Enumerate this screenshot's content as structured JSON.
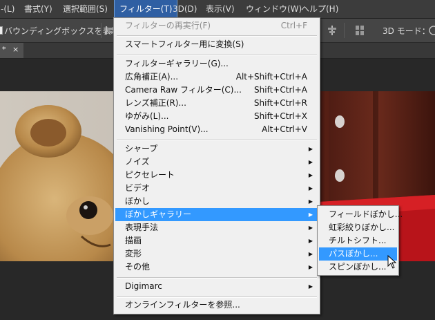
{
  "menubar": {
    "items": [
      {
        "label": "-(L)"
      },
      {
        "label": "書式(Y)"
      },
      {
        "label": "選択範囲(S)"
      },
      {
        "label": "フィルター(T)"
      },
      {
        "label": "3D(D)"
      },
      {
        "label": "表示(V)"
      },
      {
        "label": "ウィンドウ(W)"
      },
      {
        "label": "ヘルプ(H)"
      }
    ]
  },
  "options_bar": {
    "show_bounding_box_label": "バウンディングボックスを表示",
    "mode_label": "3D モード："
  },
  "document_tab": {
    "modified_mark": "*",
    "close_glyph": "×"
  },
  "filter_menu": {
    "items": [
      {
        "label": "フィルターの再実行(F)",
        "shortcut": "Ctrl+F"
      },
      {
        "label": "スマートフィルター用に変換(S)",
        "shortcut": ""
      },
      {
        "label": "フィルターギャラリー(G)...",
        "shortcut": ""
      },
      {
        "label": "広角補正(A)...",
        "shortcut": "Alt+Shift+Ctrl+A"
      },
      {
        "label": "Camera Raw フィルター(C)...",
        "shortcut": "Shift+Ctrl+A"
      },
      {
        "label": "レンズ補正(R)...",
        "shortcut": "Shift+Ctrl+R"
      },
      {
        "label": "ゆがみ(L)...",
        "shortcut": "Shift+Ctrl+X"
      },
      {
        "label": "Vanishing Point(V)...",
        "shortcut": "Alt+Ctrl+V"
      },
      {
        "label": "シャープ",
        "shortcut": ""
      },
      {
        "label": "ノイズ",
        "shortcut": ""
      },
      {
        "label": "ピクセレート",
        "shortcut": ""
      },
      {
        "label": "ビデオ",
        "shortcut": ""
      },
      {
        "label": "ぼかし",
        "shortcut": ""
      },
      {
        "label": "ぼかしギャラリー",
        "shortcut": ""
      },
      {
        "label": "表現手法",
        "shortcut": ""
      },
      {
        "label": "描画",
        "shortcut": ""
      },
      {
        "label": "変形",
        "shortcut": ""
      },
      {
        "label": "その他",
        "shortcut": ""
      },
      {
        "label": "Digimarc",
        "shortcut": ""
      },
      {
        "label": "オンラインフィルターを参照...",
        "shortcut": ""
      }
    ],
    "submenu_arrow": "▶"
  },
  "blur_gallery_submenu": {
    "items": [
      {
        "label": "フィールドぼかし..."
      },
      {
        "label": "虹彩絞りぼかし..."
      },
      {
        "label": "チルトシフト..."
      },
      {
        "label": "パスぼかし..."
      },
      {
        "label": "スピンぼかし..."
      }
    ]
  },
  "colors": {
    "highlight": "#3399ff",
    "active_menu": "#2f5fa3",
    "menu_bg": "#f0f0f0",
    "app_bg": "#3c3c3c"
  },
  "icons": [
    "checkbox-icon",
    "align-icon",
    "distribute-icon",
    "submenu-arrow-icon",
    "mouse-cursor-icon",
    "3d-mode-icon"
  ]
}
